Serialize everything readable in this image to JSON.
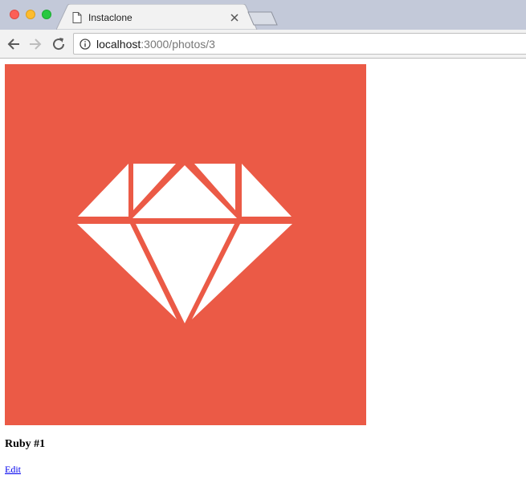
{
  "browser": {
    "tab": {
      "title": "Instaclone"
    },
    "address_bar": {
      "host": "localhost",
      "path": ":3000/photos/3"
    }
  },
  "page": {
    "photo": {
      "alt": "Ruby #1",
      "background_color": "#eb5a46",
      "icon": "diamond-icon"
    },
    "title": "Ruby #1",
    "edit_link": "Edit"
  }
}
